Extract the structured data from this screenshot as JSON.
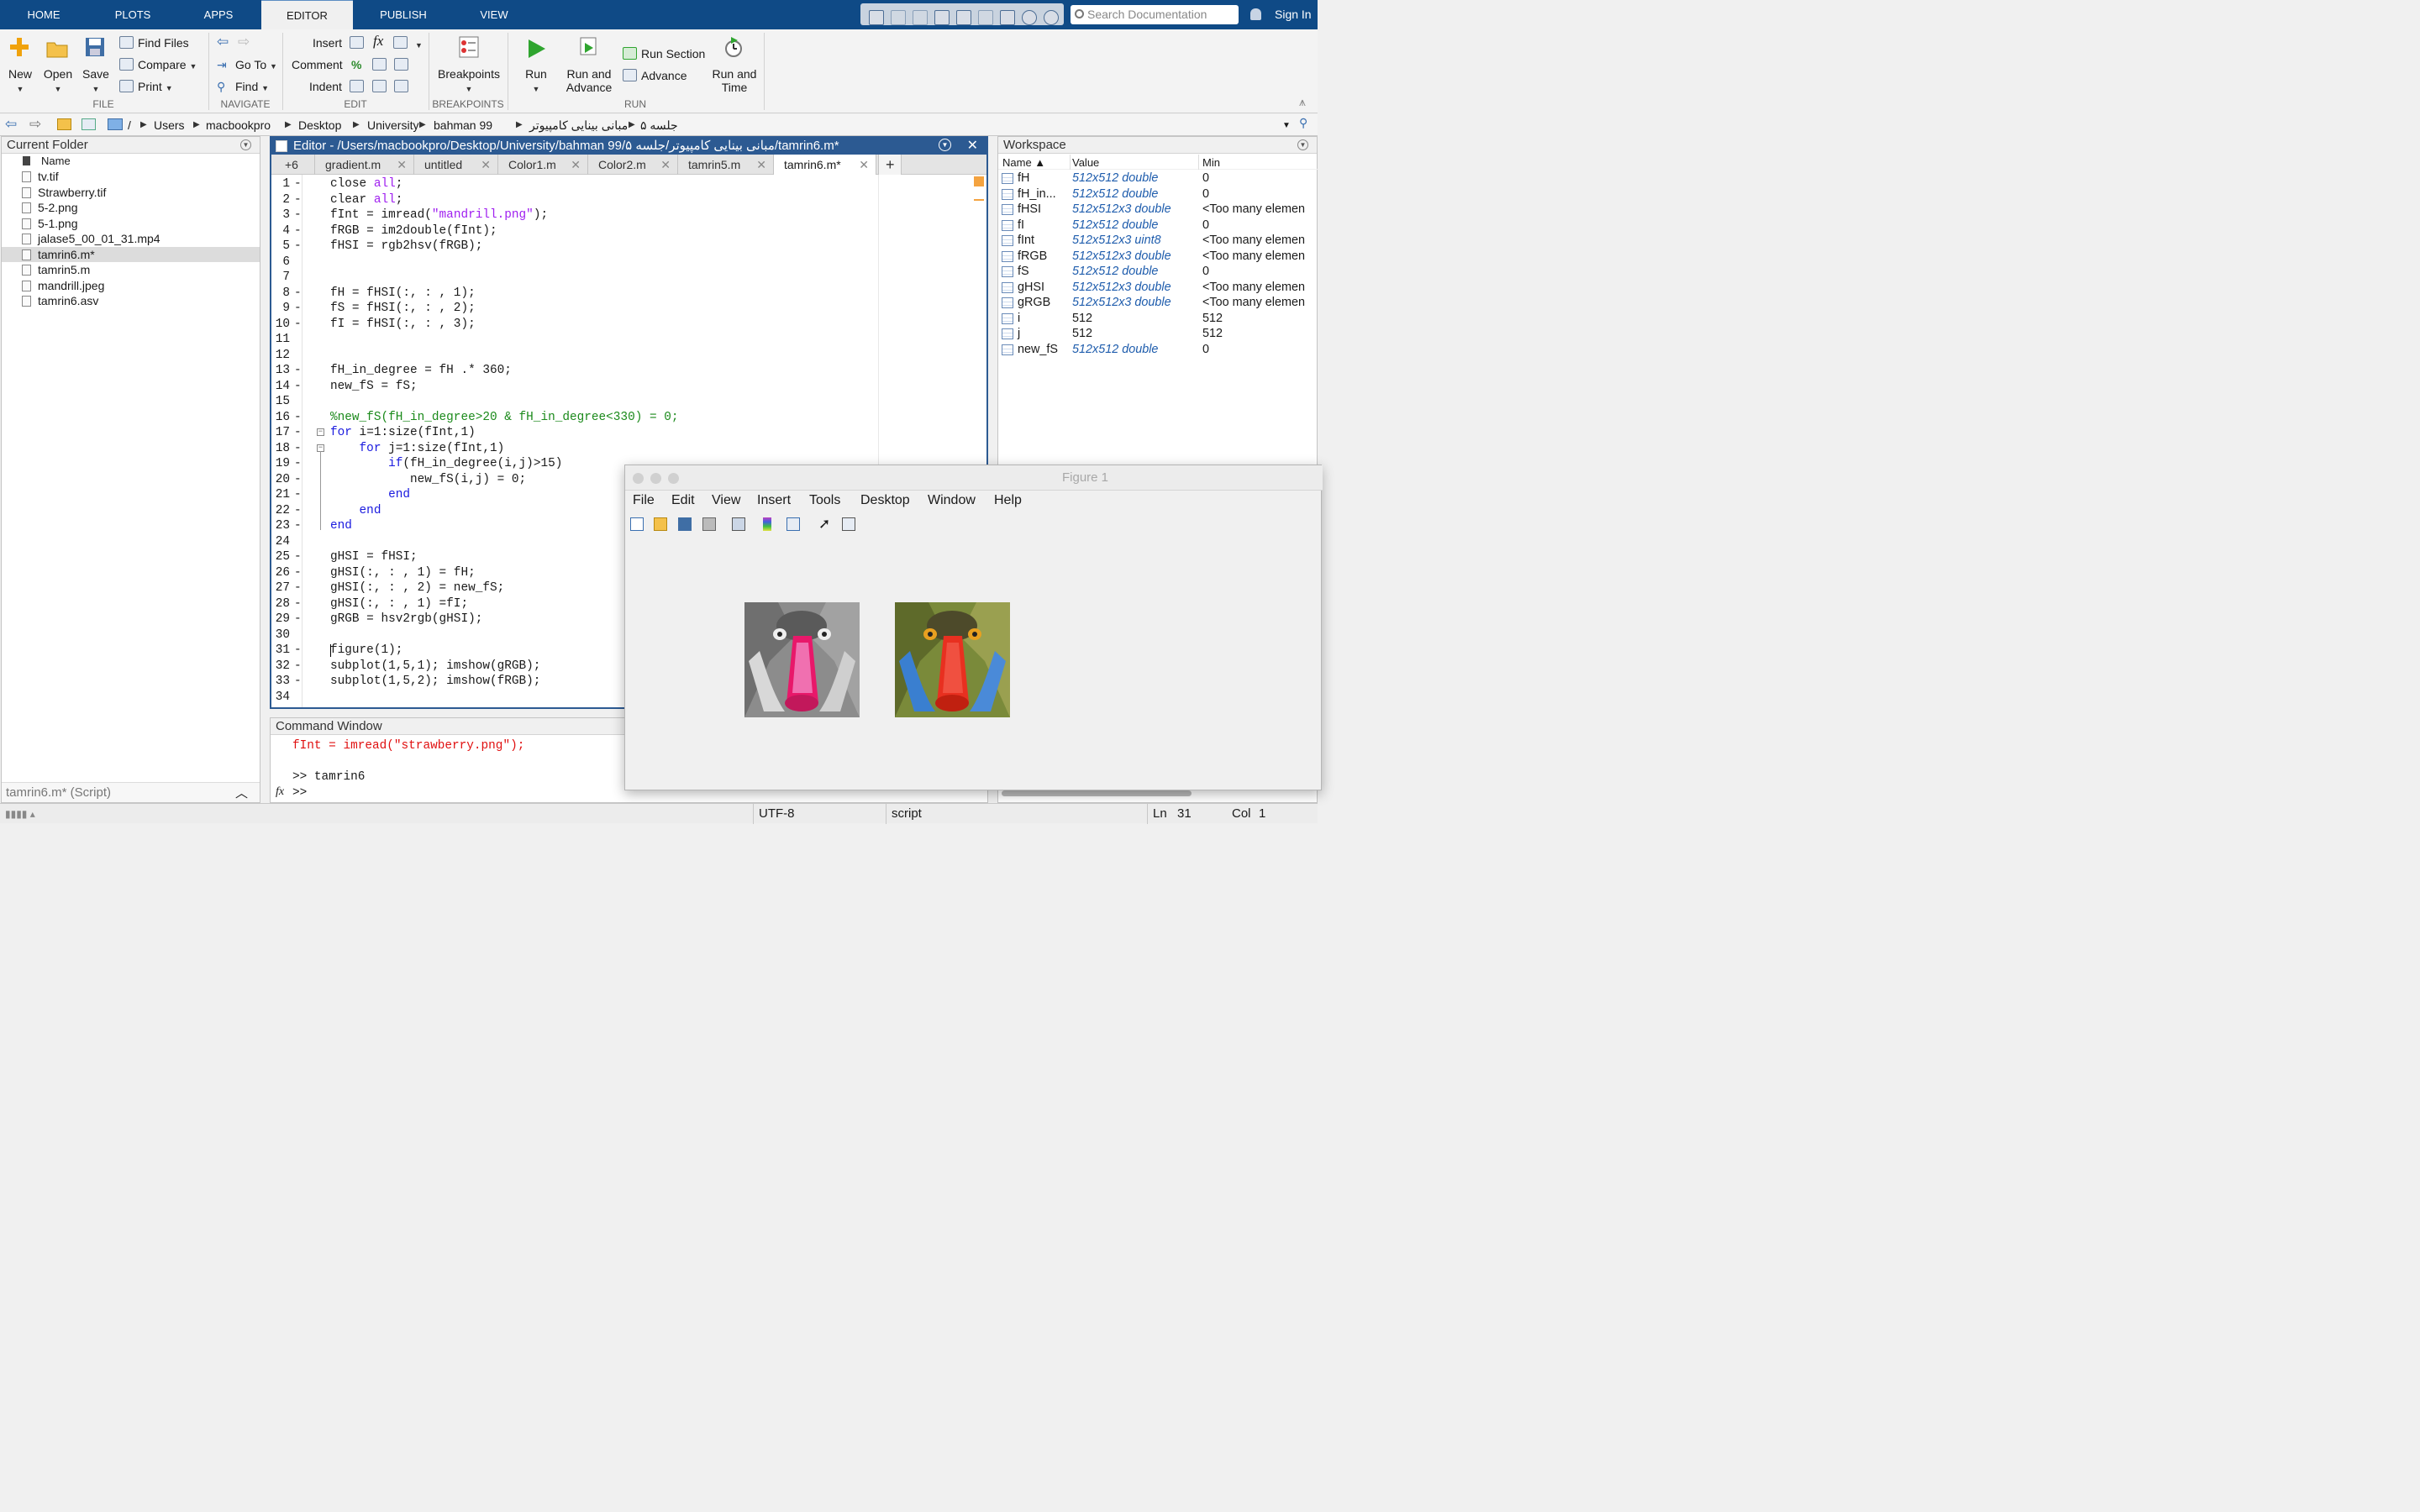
{
  "top_tabs": [
    "HOME",
    "PLOTS",
    "APPS",
    "EDITOR",
    "PUBLISH",
    "VIEW"
  ],
  "search_placeholder": "Search Documentation",
  "sign_in": "Sign In",
  "ribbon": {
    "file": {
      "new": "New",
      "open": "Open",
      "save": "Save",
      "find_files": "Find Files",
      "compare": "Compare",
      "print": "Print",
      "label": "FILE"
    },
    "navigate": {
      "goto": "Go To",
      "find": "Find",
      "label": "NAVIGATE"
    },
    "edit": {
      "insert": "Insert",
      "comment": "Comment",
      "indent": "Indent",
      "label": "EDIT"
    },
    "breakpoints": {
      "btn": "Breakpoints",
      "label": "BREAKPOINTS"
    },
    "run": {
      "run": "Run",
      "run_advance": "Run and Advance",
      "run_section": "Run Section",
      "advance": "Advance",
      "run_time": "Run and Time",
      "label": "RUN"
    }
  },
  "path": [
    "/",
    "Users",
    "macbookpro",
    "Desktop",
    "University",
    "bahman 99",
    "مبانی بینایی کامپیوتر",
    "جلسه ۵"
  ],
  "current_folder": {
    "title": "Current Folder",
    "col_name": "Name",
    "files": [
      "tv.tif",
      "Strawberry.tif",
      "5-2.png",
      "5-1.png",
      "jalase5_00_01_31.mp4",
      "tamrin6.m*",
      "tamrin5.m",
      "mandrill.jpeg",
      "tamrin6.asv"
    ],
    "selected": "tamrin6.m*",
    "footer": "tamrin6.m* (Script)"
  },
  "editor": {
    "title": "Editor - /Users/macbookpro/Desktop/University/bahman 99/مبانی بینایی کامپیوتر/جلسه ۵/tamrin6.m*",
    "tabs_overflow": "+6",
    "tabs": [
      "gradient.m",
      "untitled",
      "Color1.m",
      "Color2.m",
      "tamrin5.m",
      "tamrin6.m*"
    ],
    "active_tab": "tamrin6.m*",
    "lines": [
      "close all;",
      "clear all;",
      "fInt = imread(\"mandrill.png\");",
      "fRGB = im2double(fInt);",
      "fHSI = rgb2hsv(fRGB);",
      "",
      "",
      "fH = fHSI(:, : , 1);",
      "fS = fHSI(:, : , 2);",
      "fI = fHSI(:, : , 3);",
      "",
      "",
      "fH_in_degree = fH .* 360;",
      "new_fS = fS;",
      "",
      "%new_fS(fH_in_degree>20 & fH_in_degree<330) = 0;",
      "for i=1:size(fInt,1)",
      "    for j=1:size(fInt,1)",
      "        if(fH_in_degree(i,j)>15)",
      "           new_fS(i,j) = 0;",
      "        end",
      "    end",
      "end",
      "",
      "gHSI = fHSI;",
      "gHSI(:, : , 1) = fH;",
      "gHSI(:, : , 2) = new_fS;",
      "gHSI(:, : , 1) =fI;",
      "gRGB = hsv2rgb(gHSI);",
      "",
      "figure(1);",
      "subplot(1,5,1); imshow(gRGB);",
      "subplot(1,5,2); imshow(fRGB);",
      ""
    ]
  },
  "command_window": {
    "title": "Command Window",
    "error_line": "fInt = imread(\"strawberry.png\");",
    "prompt_cmd": ">> tamrin6",
    "prompt": ">>",
    "fx": "fx"
  },
  "workspace": {
    "title": "Workspace",
    "cols": [
      "Name ▲",
      "Value",
      "Min"
    ],
    "vars": [
      {
        "name": "fH",
        "value": "512x512 double",
        "min": "0"
      },
      {
        "name": "fH_in...",
        "value": "512x512 double",
        "min": "0"
      },
      {
        "name": "fHSI",
        "value": "512x512x3 double",
        "min": "<Too many elemen"
      },
      {
        "name": "fI",
        "value": "512x512 double",
        "min": "0"
      },
      {
        "name": "fInt",
        "value": "512x512x3 uint8",
        "min": "<Too many elemen"
      },
      {
        "name": "fRGB",
        "value": "512x512x3 double",
        "min": "<Too many elemen"
      },
      {
        "name": "fS",
        "value": "512x512 double",
        "min": "0"
      },
      {
        "name": "gHSI",
        "value": "512x512x3 double",
        "min": "<Too many elemen"
      },
      {
        "name": "gRGB",
        "value": "512x512x3 double",
        "min": "<Too many elemen"
      },
      {
        "name": "i",
        "value": "512",
        "min": "512"
      },
      {
        "name": "j",
        "value": "512",
        "min": "512"
      },
      {
        "name": "new_fS",
        "value": "512x512 double",
        "min": "0"
      }
    ]
  },
  "figure": {
    "title": "Figure 1",
    "menus": [
      "File",
      "Edit",
      "View",
      "Insert",
      "Tools",
      "Desktop",
      "Window",
      "Help"
    ]
  },
  "status": {
    "encoding": "UTF-8",
    "type": "script",
    "ln_label": "Ln",
    "ln": "31",
    "col_label": "Col",
    "col": "1"
  }
}
